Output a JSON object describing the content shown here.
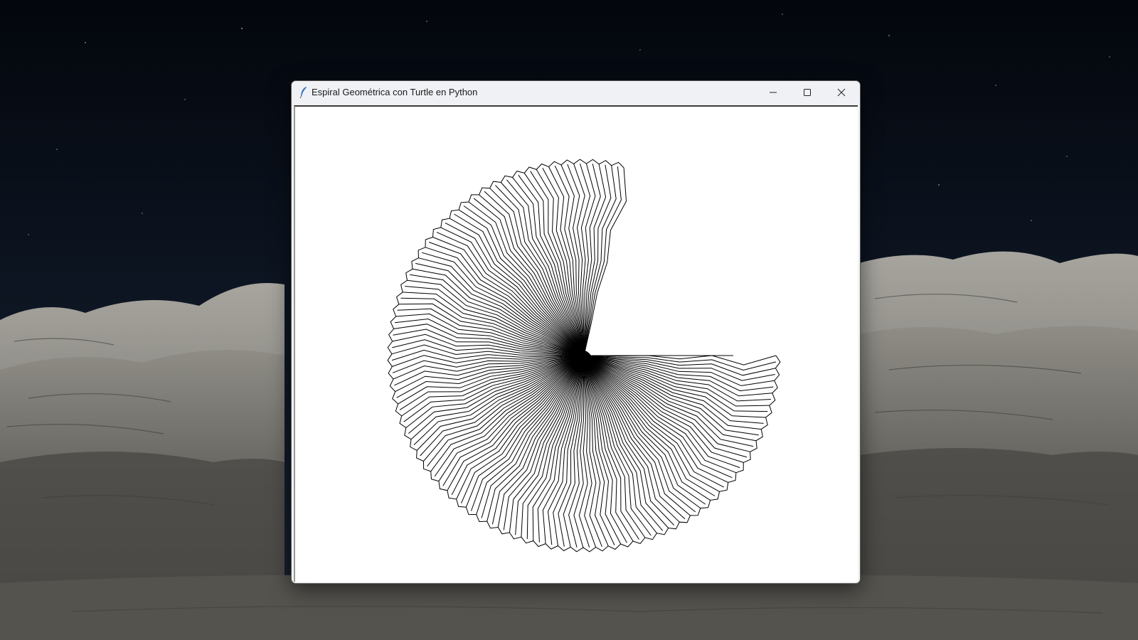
{
  "window": {
    "title": "Espiral Geométrica con Turtle en Python",
    "controls": {
      "minimize_icon": "minimize-icon",
      "maximize_icon": "maximize-icon",
      "close_icon": "close-icon"
    },
    "app_icon": "tk-feather-icon"
  },
  "canvas": {
    "background": "#ffffff",
    "pen_color": "#000000",
    "drawing": "geometric spiral fan of radiating zigzag lines with one open quadrant"
  },
  "desktop": {
    "wallpaper": "night sky over white sandstone rock formations"
  }
}
